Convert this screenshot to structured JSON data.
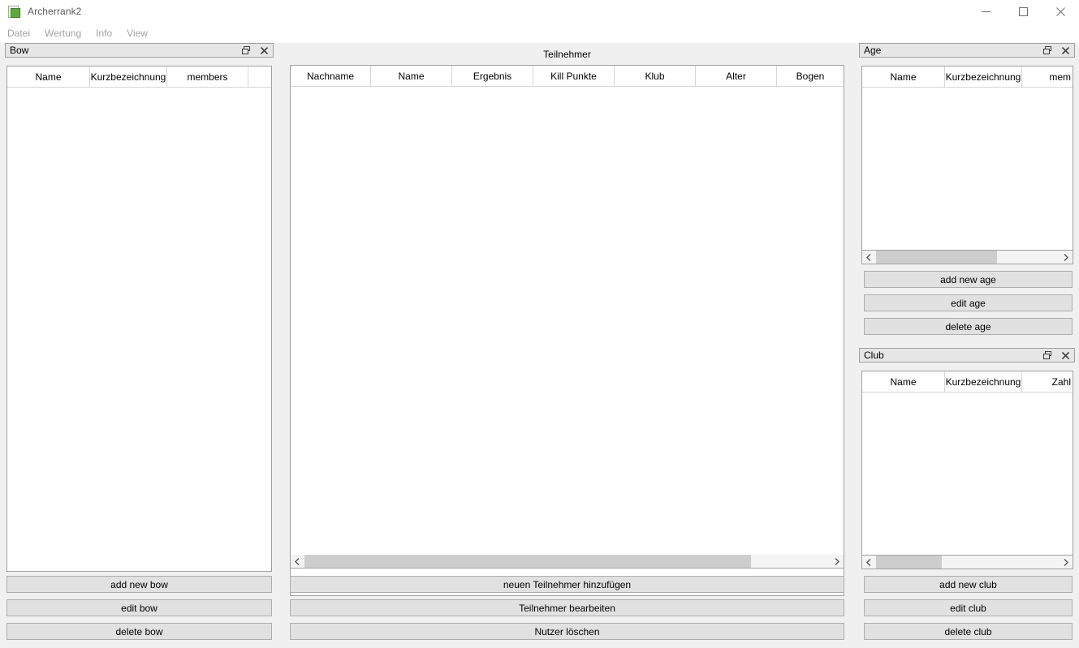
{
  "window": {
    "title": "Archerrank2",
    "icon": "app-document-icon",
    "controls": {
      "minimize": "minimize-icon",
      "maximize": "maximize-icon",
      "close": "close-icon"
    }
  },
  "menubar": {
    "items": [
      {
        "label": "Datei"
      },
      {
        "label": "Wertung"
      },
      {
        "label": "Info"
      },
      {
        "label": "View"
      }
    ]
  },
  "panels": {
    "bow": {
      "title": "Bow",
      "titlebar_icons": {
        "float": "restore-window-icon",
        "close": "close-icon"
      },
      "table": {
        "columns": [
          "Name",
          "Kurzbezeichnung",
          "members",
          ""
        ],
        "rows": []
      },
      "buttons": [
        {
          "label": "add new bow"
        },
        {
          "label": "edit bow"
        },
        {
          "label": "delete bow"
        }
      ]
    },
    "teilnehmer": {
      "title": "Teilnehmer",
      "table": {
        "columns": [
          "Nachname",
          "Name",
          "Ergebnis",
          "Kill Punkte",
          "Klub",
          "Alter",
          "Bogen"
        ],
        "rows": []
      },
      "scrollbar": {
        "left_arrow": "chevron-left-icon",
        "right_arrow": "chevron-right-icon",
        "thumb_start_pct": 0,
        "thumb_width_pct": 85
      },
      "buttons": [
        {
          "label": "neuen Teilnehmer hinzufügen"
        },
        {
          "label": "Teilnehmer bearbeiten"
        },
        {
          "label": "Nutzer löschen"
        }
      ]
    },
    "age": {
      "title": "Age",
      "titlebar_icons": {
        "float": "restore-window-icon",
        "close": "close-icon"
      },
      "table": {
        "columns": [
          "Name",
          "Kurzbezeichnung",
          "mem"
        ],
        "rows": []
      },
      "scrollbar": {
        "left_arrow": "chevron-left-icon",
        "right_arrow": "chevron-right-icon",
        "thumb_start_pct": 0,
        "thumb_width_pct": 66
      },
      "buttons": [
        {
          "label": "add new age"
        },
        {
          "label": "edit age"
        },
        {
          "label": "delete age"
        }
      ]
    },
    "club": {
      "title": "Club",
      "titlebar_icons": {
        "float": "restore-window-icon",
        "close": "close-icon"
      },
      "table": {
        "columns": [
          "Name",
          "Kurzbezeichnung",
          "Zahl"
        ],
        "rows": []
      },
      "scrollbar": {
        "left_arrow": "chevron-left-icon",
        "right_arrow": "chevron-right-icon",
        "thumb_start_pct": 0,
        "thumb_width_pct": 36
      },
      "buttons": [
        {
          "label": "add new club"
        },
        {
          "label": "edit club"
        },
        {
          "label": "delete club"
        }
      ]
    }
  },
  "colors": {
    "workspace_bg": "#f0f0f0",
    "panel_titlebar_bg": "#e6e6e6",
    "panel_border": "#a0a0a0",
    "button_bg": "#e1e1e1",
    "button_border": "#adadad",
    "scroll_thumb": "#cdcdcd",
    "menu_text": "#a2a2a2",
    "title_text": "#5b5b5b",
    "icon_green": "#5faa3c"
  }
}
